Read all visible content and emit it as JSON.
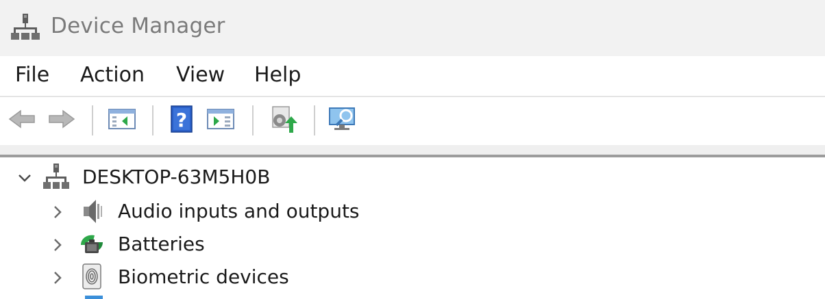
{
  "window": {
    "title": "Device Manager",
    "title_icon": "device-manager-icon"
  },
  "menu": {
    "file": "File",
    "action": "Action",
    "view": "View",
    "help": "Help"
  },
  "toolbar": {
    "buttons": [
      "back-arrow-icon",
      "forward-arrow-icon",
      "show-hide-console-tree-icon",
      "help-icon",
      "properties-panel-icon",
      "update-driver-icon",
      "scan-hardware-changes-icon"
    ]
  },
  "tree": {
    "root": {
      "label": "DESKTOP-63M5H0B",
      "expanded": true,
      "icon": "computer-icon"
    },
    "children": [
      {
        "label": "Audio inputs and outputs",
        "icon": "speaker-icon",
        "expanded": false
      },
      {
        "label": "Batteries",
        "icon": "battery-icon",
        "expanded": false
      },
      {
        "label": "Biometric devices",
        "icon": "fingerprint-icon",
        "expanded": false
      }
    ]
  },
  "colors": {
    "titlebar_bg": "#f2f2f2",
    "title_text": "#7a7a7a",
    "accent_blue": "#1f5fbf",
    "accent_green": "#2ea84a"
  }
}
